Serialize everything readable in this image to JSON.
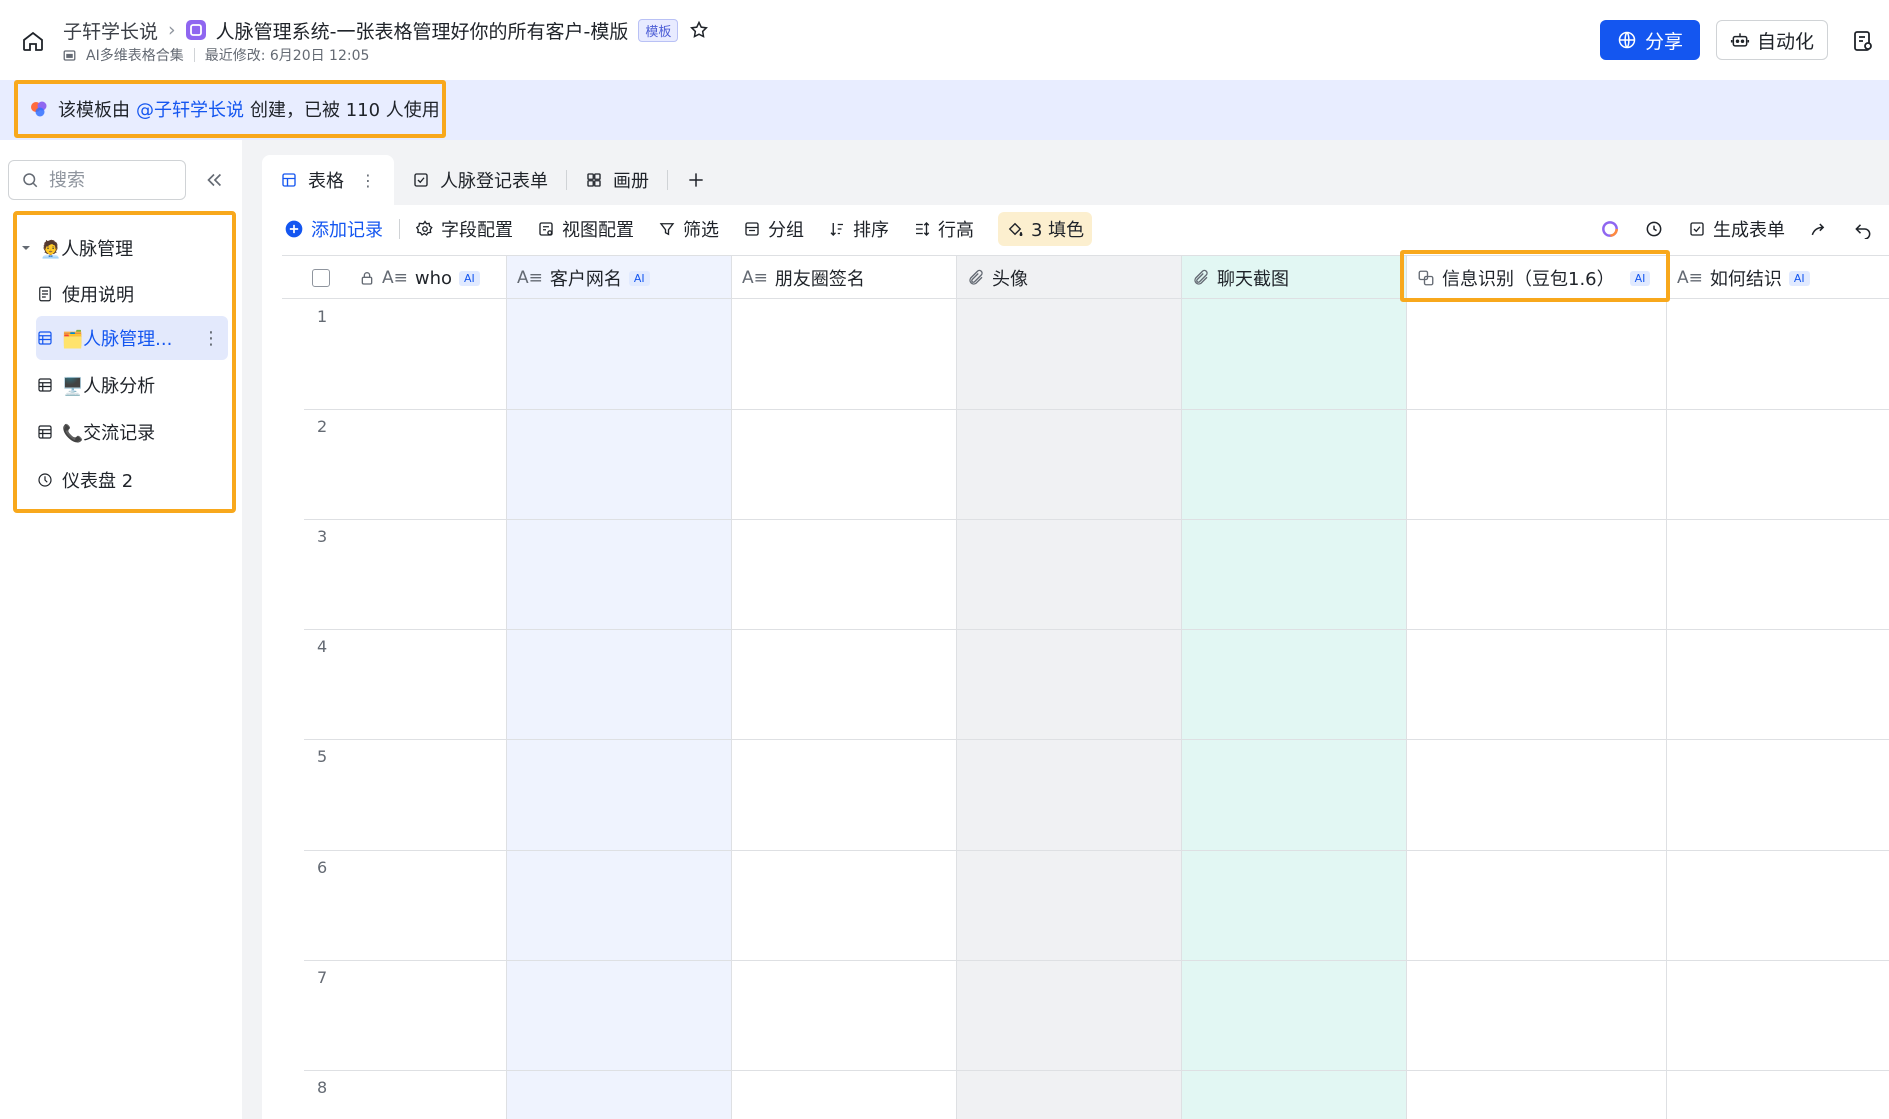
{
  "header": {
    "workspace": "子轩学长说",
    "doc_title": "人脉管理系统-一张表格管理好你的所有客户-模版",
    "template_badge": "模板",
    "collection": "AI多维表格合集",
    "last_modified": "最近修改: 6月20日 12:05",
    "share_label": "分享",
    "automation_label": "自动化"
  },
  "banner": {
    "prefix": "该模板由",
    "author": "@子轩学长说",
    "suffix": "创建，已被 110 人使用"
  },
  "sidebar": {
    "search_placeholder": "搜索",
    "root": {
      "label": "人脉管理",
      "emoji": "🧑‍💼"
    },
    "items": [
      {
        "label": "使用说明",
        "icon": "doc-icon",
        "emoji": ""
      },
      {
        "label": "人脉管理...",
        "icon": "table-icon",
        "emoji": "🗂️",
        "active": true
      },
      {
        "label": "人脉分析",
        "icon": "table-icon",
        "emoji": "🖥️"
      },
      {
        "label": "交流记录",
        "icon": "table-icon",
        "emoji": "📞"
      },
      {
        "label": "仪表盘 2",
        "icon": "dashboard-icon",
        "emoji": ""
      }
    ]
  },
  "tabs": [
    {
      "label": "表格",
      "icon": "grid-view-icon",
      "active": true
    },
    {
      "label": "人脉登记表单",
      "icon": "form-view-icon"
    },
    {
      "label": "画册",
      "icon": "gallery-view-icon"
    }
  ],
  "toolbar": {
    "add_record": "添加记录",
    "field_config": "字段配置",
    "view_config": "视图配置",
    "filter": "筛选",
    "group": "分组",
    "sort": "排序",
    "row_height": "行高",
    "fill_color": "3 填色",
    "generate_form": "生成表单"
  },
  "table": {
    "columns": [
      {
        "label": "who",
        "icon": "text-field-icon",
        "ai": "AI",
        "locked": true,
        "tint": "#ffffff"
      },
      {
        "label": "客户网名",
        "icon": "text-field-icon",
        "ai": "AI",
        "tint": "#eff3fe"
      },
      {
        "label": "朋友圈签名",
        "icon": "text-field-icon",
        "ai": "",
        "tint": "#ffffff"
      },
      {
        "label": "头像",
        "icon": "attachment-icon",
        "ai": "",
        "tint": "#f0f1f3"
      },
      {
        "label": "聊天截图",
        "icon": "attachment-icon",
        "ai": "",
        "tint": "#e2f7f3"
      },
      {
        "label": "信息识别（豆包1.6）",
        "icon": "ai-extract-icon",
        "ai": "AI",
        "tint": "#ffffff"
      },
      {
        "label": "如何结识",
        "icon": "text-field-icon",
        "ai": "AI",
        "tint": "#ffffff"
      }
    ],
    "row_numbers": [
      "1",
      "2",
      "3",
      "4",
      "5",
      "6",
      "7",
      "8"
    ]
  },
  "colors": {
    "accent": "#1456f0",
    "highlight_border": "#f8a81c",
    "banner_bg": "#e8edff"
  }
}
